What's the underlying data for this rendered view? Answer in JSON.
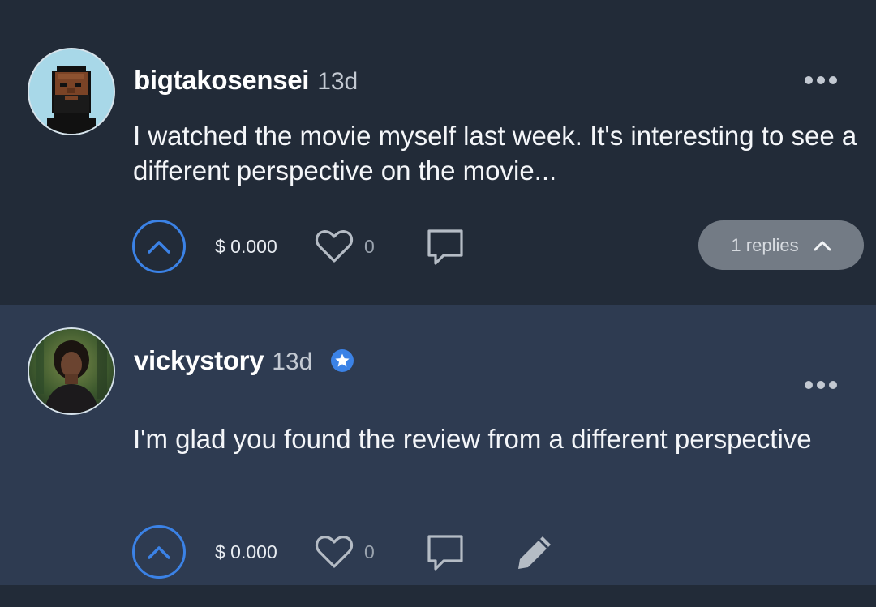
{
  "comments": [
    {
      "username": "bigtakosensei",
      "age": "13d",
      "text": "I watched the movie myself last week. It's interesting to see a different perspective on the movie...",
      "amount": "$ 0.000",
      "likes": "0",
      "replies_label": "1 replies",
      "avatar": "pixel-art-avatar"
    },
    {
      "username": "vickystory",
      "age": "13d",
      "text": "I'm glad you found the review from a different perspective",
      "amount": "$ 0.000",
      "likes": "0",
      "verified": true,
      "avatar": "photo-avatar"
    }
  ],
  "colors": {
    "background_dark": "#222b38",
    "background_highlight": "#2e3b51",
    "accent_blue": "#3b82e6",
    "pill_gray": "#737b85"
  },
  "icons": [
    "upvote-icon",
    "heart-icon",
    "comment-icon",
    "edit-icon",
    "more-icon",
    "verified-icon",
    "chevron-up-icon"
  ]
}
